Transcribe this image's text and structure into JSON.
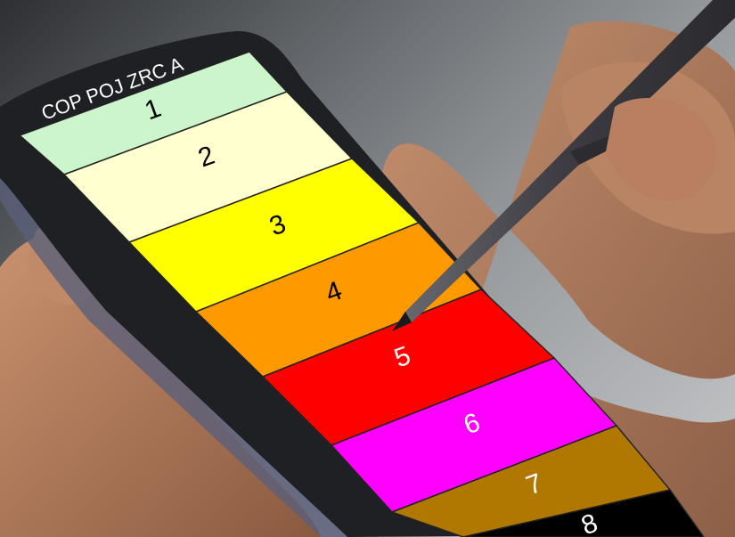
{
  "header": {
    "title": "COP POJ ZRC A"
  },
  "bands": [
    {
      "label": "1",
      "color": "#ccf5cc",
      "text_color": "#000000"
    },
    {
      "label": "2",
      "color": "#ffffd0",
      "text_color": "#000000"
    },
    {
      "label": "3",
      "color": "#ffff00",
      "text_color": "#000000"
    },
    {
      "label": "4",
      "color": "#ff9900",
      "text_color": "#000000"
    },
    {
      "label": "5",
      "color": "#ff0000",
      "text_color": "#ffffff"
    },
    {
      "label": "6",
      "color": "#ff00ff",
      "text_color": "#ffffff"
    },
    {
      "label": "7",
      "color": "#b07800",
      "text_color": "#ffffff"
    },
    {
      "label": "8",
      "color": "#000000",
      "text_color": "#ffffff"
    }
  ],
  "colors": {
    "phone_frame": "#1f2024",
    "stylus": "#4a4a4e",
    "skin": "#b07a5a"
  }
}
